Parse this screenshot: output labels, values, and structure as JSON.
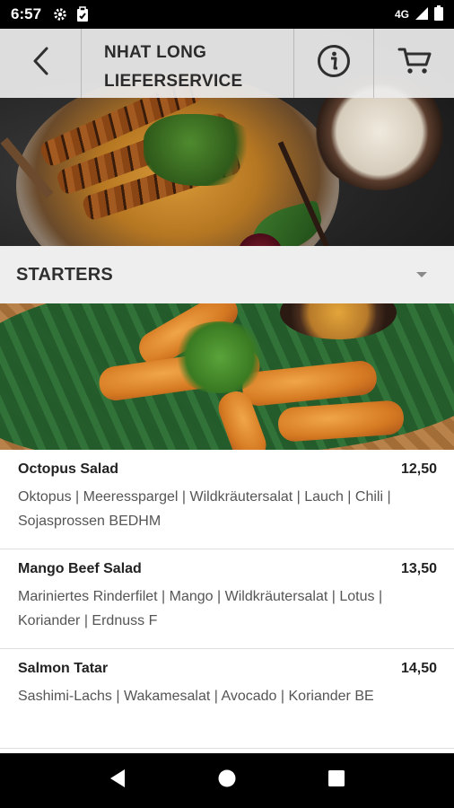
{
  "status_bar": {
    "time": "6:57",
    "network": "4G",
    "icons": [
      "gear-icon",
      "clipboard-icon",
      "signal-icon",
      "battery-icon"
    ]
  },
  "header": {
    "title_line1": "NHAT LONG",
    "title_line2": "LIEFERSERVICE",
    "icons": [
      "back-arrow-icon",
      "info-icon",
      "cart-icon"
    ]
  },
  "category": {
    "label": "STARTERS",
    "icon": "dropdown-arrow-icon"
  },
  "menu": {
    "items": [
      {
        "name": "Octopus Salad",
        "price": "12,50",
        "description": "Oktopus | Meeresspargel | Wildkräutersalat | Lauch | Chili | Sojasprossen BEDHM"
      },
      {
        "name": "Mango Beef Salad",
        "price": "13,50",
        "description": "Mariniertes Rinderfilet | Mango | Wildkräutersalat | Lotus | Koriander | Erdnuss F"
      },
      {
        "name": "Salmon Tatar",
        "price": "14,50",
        "description": "Sashimi-Lachs | Wakamesalat | Avocado | Koriander BE"
      }
    ]
  },
  "nav_bar": {
    "icons": [
      "back-triangle-icon",
      "home-circle-icon",
      "recents-square-icon"
    ]
  },
  "colors": {
    "header_bg": "#ececec",
    "category_bg": "#eeeeee",
    "text_dark": "#222222",
    "text_muted": "#555555"
  }
}
